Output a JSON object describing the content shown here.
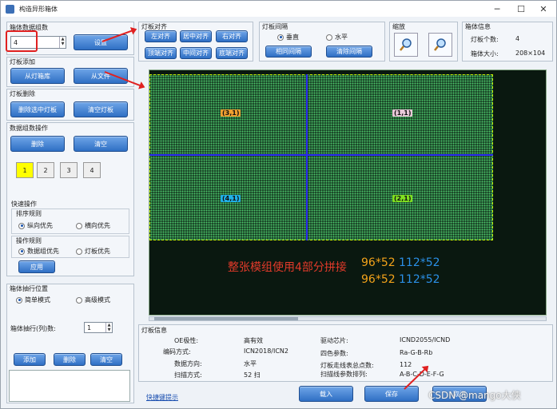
{
  "window": {
    "title": "构造异形箱体"
  },
  "left": {
    "group_count": {
      "title": "箱体数据组数",
      "value": "4",
      "set_btn": "设置"
    },
    "panel_add": {
      "title": "灯板添加",
      "from_lib": "从灯箱库",
      "from_file": "从文件"
    },
    "panel_del": {
      "title": "灯板删除",
      "del_selected": "删除选中灯板",
      "clear": "清空灯板"
    },
    "data_group": {
      "title": "数据组数操作",
      "del": "删除",
      "clear": "清空",
      "nums": [
        "1",
        "2",
        "3",
        "4"
      ]
    },
    "quick": {
      "title": "快速操作",
      "sort_title": "排序规则",
      "sort_opts": [
        "纵向优先",
        "横向优先"
      ],
      "op_title": "操作规则",
      "op_opts": [
        "数据组优先",
        "灯板优先"
      ],
      "apply": "应用"
    },
    "order": {
      "title": "箱体抽行位置",
      "modes": [
        "简单模式",
        "高级模式"
      ],
      "row_label": "箱体抽行(列)数:",
      "row_value": "1",
      "add": "添加",
      "del": "删除",
      "clear": "清空"
    }
  },
  "top": {
    "align": {
      "title": "灯板对齐",
      "buttons": [
        "左对齐",
        "居中对齐",
        "右对齐",
        "顶端对齐",
        "中间对齐",
        "底端对齐"
      ]
    },
    "gap": {
      "title": "灯板间隔",
      "opts": [
        "垂直",
        "水平"
      ],
      "same": "相同间隔",
      "clear": "清除间隔"
    },
    "zoom": {
      "title": "缩放"
    },
    "info": {
      "title": "箱体信息",
      "count_label": "灯板个数:",
      "count": "4",
      "size_label": "箱体大小:",
      "size": "208×104"
    }
  },
  "canvas": {
    "tags": [
      "(3,1)",
      "(1,1)",
      "(4,1)",
      "(2,1)"
    ],
    "note": "整张模组使用4部分拼接",
    "dims1a": "96*52",
    "dims1b": "112*52",
    "dims2a": "96*52",
    "dims2b": "112*52"
  },
  "panel_info": {
    "title": "灯板信息",
    "rows_left": [
      {
        "k": "OE极性:",
        "v": "高有效"
      },
      {
        "k": "编码方式:",
        "v": "ICN2018/ICN2"
      },
      {
        "k": "数据方向:",
        "v": "水平"
      },
      {
        "k": "扫描方式:",
        "v": "52 扫"
      }
    ],
    "rows_right": [
      {
        "k": "驱动芯片:",
        "v": "ICND2055/ICND"
      },
      {
        "k": "四色参数:",
        "v": "Ra-G-B-Rb"
      },
      {
        "k": "灯板走线表总点数:",
        "v": "112"
      },
      {
        "k": "扫描线参数排列:",
        "v": "A-B-C-D-E-F-G"
      }
    ]
  },
  "bottom": {
    "shortcut": "快捷键提示",
    "load": "载入",
    "save": "保存",
    "cancel": "取消"
  },
  "watermark": "CSDN @mango大侠"
}
